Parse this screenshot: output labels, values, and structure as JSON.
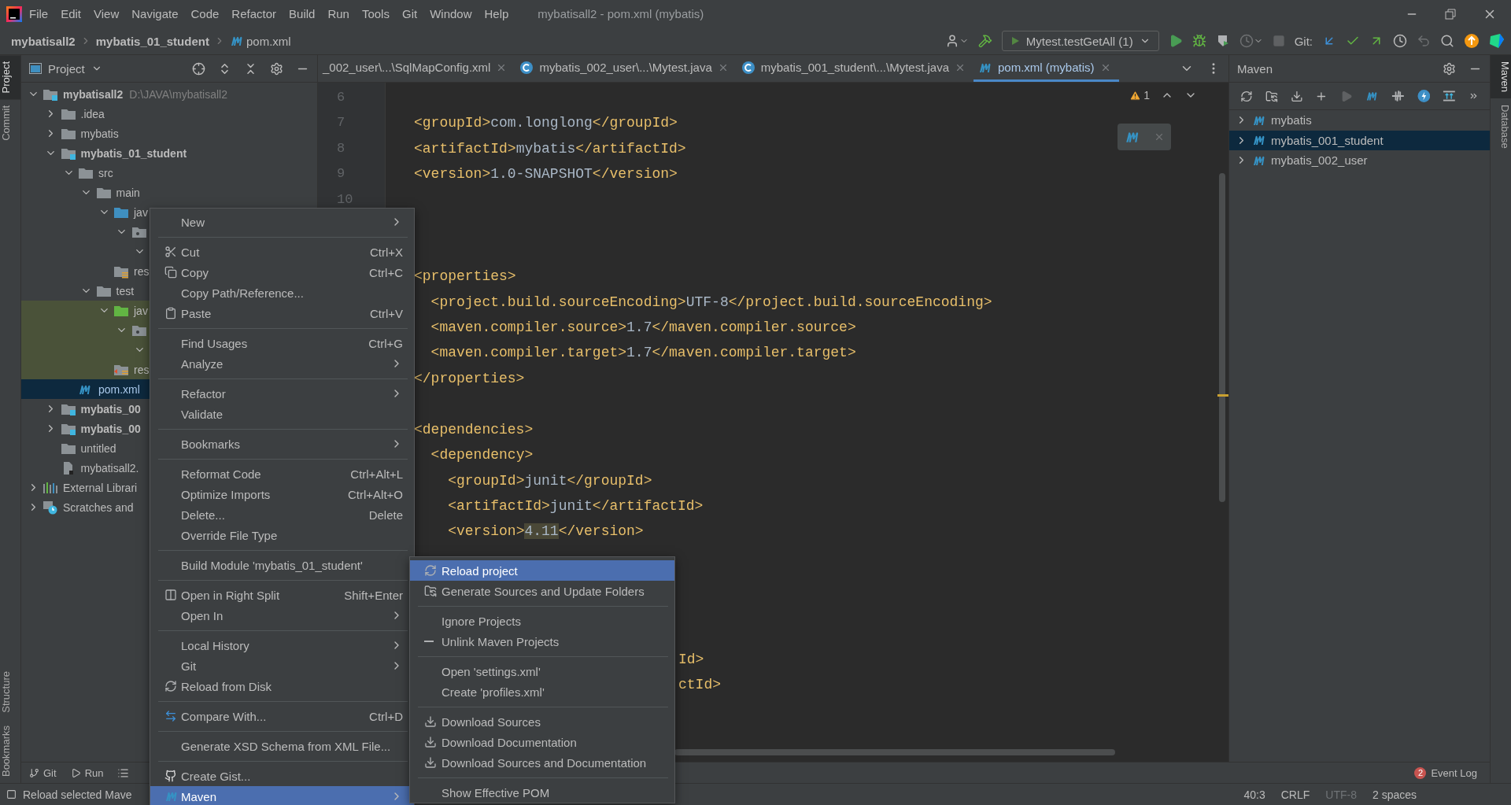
{
  "menu_bar": {
    "items": [
      "File",
      "Edit",
      "View",
      "Navigate",
      "Code",
      "Refactor",
      "Build",
      "Run",
      "Tools",
      "Git",
      "Window",
      "Help"
    ],
    "title": "mybatisall2 - pom.xml (mybatis)"
  },
  "nav_bar": {
    "breadcrumbs": [
      {
        "label": "mybatisall2",
        "kind": "text"
      },
      {
        "label": "mybatis_01_student",
        "kind": "text"
      },
      {
        "label": "pom.xml",
        "kind": "maven"
      }
    ],
    "run_config": "Mytest.testGetAll (1)",
    "git_label": "Git:"
  },
  "left_strip": {
    "top": [
      {
        "label": "Project",
        "selected": true
      },
      {
        "label": "Commit",
        "selected": false
      }
    ],
    "bottom": [
      {
        "label": "Structure",
        "selected": false
      },
      {
        "label": "Bookmarks",
        "selected": false
      }
    ]
  },
  "project_panel": {
    "title": "Project",
    "tree": [
      {
        "label": "mybatisall2",
        "detail": "D:\\JAVA\\mybatisall2",
        "kind": "module",
        "expanded": true,
        "selected": false,
        "children": [
          {
            "label": ".idea",
            "kind": "folder",
            "expanded": false,
            "selected": false
          },
          {
            "label": "mybatis",
            "kind": "folder",
            "expanded": false,
            "selected": false
          },
          {
            "label": "mybatis_01_student",
            "kind": "module",
            "expanded": true,
            "selected": false,
            "children": [
              {
                "label": "src",
                "kind": "folder",
                "expanded": true,
                "selected": false,
                "children": [
                  {
                    "label": "main",
                    "kind": "folder",
                    "expanded": true,
                    "selected": false,
                    "children": [
                      {
                        "label": "jav",
                        "kind": "source",
                        "expanded": true,
                        "selected": false,
                        "children": [
                          {
                            "kind": "package",
                            "expanded": true,
                            "selected": false,
                            "children": [
                              {
                                "expanded": true,
                                "selected": false
                              }
                            ]
                          }
                        ]
                      },
                      {
                        "label": "res",
                        "kind": "resources",
                        "selected": false
                      }
                    ]
                  },
                  {
                    "label": "test",
                    "kind": "folder",
                    "expanded": true,
                    "selected": false,
                    "children": [
                      {
                        "label": "jav",
                        "kind": "test-source",
                        "expanded": true,
                        "selected": false,
                        "highlighted": true,
                        "children": [
                          {
                            "kind": "package",
                            "expanded": true,
                            "selected": false,
                            "highlighted": true,
                            "children": [
                              {
                                "expanded": true,
                                "selected": false,
                                "highlighted": true
                              }
                            ]
                          }
                        ]
                      },
                      {
                        "label": "res",
                        "kind": "test-resources",
                        "selected": false,
                        "highlighted": true
                      }
                    ]
                  }
                ]
              },
              {
                "label": "pom.xml",
                "kind": "maven",
                "selected": true
              }
            ]
          },
          {
            "label": "mybatis_00",
            "kind": "module",
            "expanded": false,
            "selected": false
          },
          {
            "label": "mybatis_00",
            "kind": "module",
            "expanded": false,
            "selected": false
          },
          {
            "label": "untitled",
            "kind": "folder",
            "selected": false
          },
          {
            "label": "mybatisall2.",
            "kind": "file",
            "selected": false
          }
        ]
      },
      {
        "label": "External Librari",
        "kind": "library",
        "expanded": false,
        "selected": false
      },
      {
        "label": "Scratches and",
        "kind": "scratches",
        "expanded": false,
        "selected": false
      }
    ]
  },
  "editor": {
    "tabs": [
      {
        "label": "_002_user\\...\\SqlMapConfig.xml",
        "kind": "xml",
        "selected": false
      },
      {
        "label": "mybatis_002_user\\...\\Mytest.java",
        "kind": "class",
        "selected": false
      },
      {
        "label": "mybatis_001_student\\...\\Mytest.java",
        "kind": "class",
        "selected": false
      },
      {
        "label": "pom.xml (mybatis)",
        "kind": "maven",
        "selected": true
      }
    ],
    "warning_count": "1",
    "lines": [
      {
        "kind": "blank",
        "number": "6"
      },
      {
        "kind": "code",
        "number": "7",
        "text": "<groupId>com.longlong</groupId>"
      },
      {
        "kind": "code",
        "number": "8",
        "text": "<artifactId>mybatis</artifactId>"
      },
      {
        "kind": "code",
        "number": "9",
        "text": "<version>1.0-SNAPSHOT</version>"
      },
      {
        "kind": "blank",
        "number": "10"
      },
      {
        "kind": "blank"
      },
      {
        "kind": "blank"
      },
      {
        "kind": "code",
        "text": "<properties>"
      },
      {
        "kind": "code",
        "text": "  <project.build.sourceEncoding>UTF-8</project.build.sourceEncoding>"
      },
      {
        "kind": "code",
        "text": "  <maven.compiler.source>1.7</maven.compiler.source>"
      },
      {
        "kind": "code",
        "text": "  <maven.compiler.target>1.7</maven.compiler.target>"
      },
      {
        "kind": "code",
        "text": "</properties>"
      },
      {
        "kind": "blank"
      },
      {
        "kind": "code",
        "text": "<dependencies>"
      },
      {
        "kind": "code",
        "text": "  <dependency>"
      },
      {
        "kind": "code",
        "text": "    <groupId>junit</groupId>"
      },
      {
        "kind": "code",
        "text": "    <artifactId>junit</artifactId>"
      },
      {
        "kind": "parts",
        "parts": [
          {
            "text": "    <version>",
            "highlighted": false
          },
          {
            "text": "4.11",
            "highlighted": true
          },
          {
            "text": "</version>",
            "highlighted": false
          }
        ]
      },
      {
        "kind": "blank"
      },
      {
        "kind": "blank"
      },
      {
        "kind": "blank"
      },
      {
        "kind": "blank"
      },
      {
        "kind": "fragment",
        "text": "Id>"
      },
      {
        "kind": "fragment",
        "text": "ctId>"
      }
    ]
  },
  "context_menu": {
    "items": [
      {
        "label": "New",
        "kind": "plain",
        "submenu": true,
        "selected": false
      },
      {
        "kind": "separator"
      },
      {
        "label": "Cut",
        "kind": "cut",
        "shortcut": "Ctrl+X",
        "submenu": false,
        "selected": false
      },
      {
        "label": "Copy",
        "kind": "copy",
        "shortcut": "Ctrl+C",
        "submenu": false,
        "selected": false
      },
      {
        "label": "Copy Path/Reference...",
        "kind": "plain",
        "submenu": false,
        "selected": false
      },
      {
        "label": "Paste",
        "kind": "paste",
        "shortcut": "Ctrl+V",
        "submenu": false,
        "selected": false
      },
      {
        "kind": "separator"
      },
      {
        "label": "Find Usages",
        "kind": "plain",
        "shortcut": "Ctrl+G",
        "submenu": false,
        "selected": false
      },
      {
        "label": "Analyze",
        "kind": "plain",
        "submenu": true,
        "selected": false
      },
      {
        "kind": "separator"
      },
      {
        "label": "Refactor",
        "kind": "plain",
        "submenu": true,
        "selected": false
      },
      {
        "label": "Validate",
        "kind": "plain",
        "submenu": false,
        "selected": false
      },
      {
        "kind": "separator"
      },
      {
        "label": "Bookmarks",
        "kind": "plain",
        "submenu": true,
        "selected": false
      },
      {
        "kind": "separator"
      },
      {
        "label": "Reformat Code",
        "kind": "plain",
        "shortcut": "Ctrl+Alt+L",
        "submenu": false,
        "selected": false
      },
      {
        "label": "Optimize Imports",
        "kind": "plain",
        "shortcut": "Ctrl+Alt+O",
        "submenu": false,
        "selected": false
      },
      {
        "label": "Delete...",
        "kind": "plain",
        "shortcut": "Delete",
        "submenu": false,
        "selected": false
      },
      {
        "label": "Override File Type",
        "kind": "plain",
        "submenu": false,
        "selected": false
      },
      {
        "kind": "separator"
      },
      {
        "label": "Build Module 'mybatis_01_student'",
        "kind": "plain",
        "submenu": false,
        "selected": false
      },
      {
        "kind": "separator"
      },
      {
        "label": "Open in Right Split",
        "kind": "split",
        "shortcut": "Shift+Enter",
        "submenu": false,
        "selected": false
      },
      {
        "label": "Open In",
        "kind": "plain",
        "submenu": true,
        "selected": false
      },
      {
        "kind": "separator"
      },
      {
        "label": "Local History",
        "kind": "plain",
        "submenu": true,
        "selected": false
      },
      {
        "label": "Git",
        "kind": "plain",
        "submenu": true,
        "selected": false
      },
      {
        "label": "Reload from Disk",
        "kind": "reload",
        "submenu": false,
        "selected": false
      },
      {
        "kind": "separator"
      },
      {
        "label": "Compare With...",
        "kind": "compare",
        "shortcut": "Ctrl+D",
        "submenu": false,
        "selected": false
      },
      {
        "kind": "separator"
      },
      {
        "label": "Generate XSD Schema from XML File...",
        "kind": "plain",
        "submenu": false,
        "selected": false
      },
      {
        "kind": "separator"
      },
      {
        "label": "Create Gist...",
        "kind": "gist",
        "submenu": false,
        "selected": false
      },
      {
        "label": "Maven",
        "kind": "maven",
        "submenu": true,
        "selected": true
      }
    ]
  },
  "maven_submenu": {
    "items": [
      {
        "label": "Reload project",
        "kind": "reload",
        "selected": true
      },
      {
        "label": "Generate Sources and Update Folders",
        "kind": "generate",
        "selected": false
      },
      {
        "kind": "separator"
      },
      {
        "label": "Ignore Projects",
        "kind": "plain",
        "selected": false
      },
      {
        "label": "Unlink Maven Projects",
        "kind": "unlink",
        "selected": false
      },
      {
        "kind": "separator"
      },
      {
        "label": "Open 'settings.xml'",
        "kind": "plain",
        "selected": false
      },
      {
        "label": "Create 'profiles.xml'",
        "kind": "plain",
        "selected": false
      },
      {
        "kind": "separator"
      },
      {
        "label": "Download Sources",
        "kind": "download",
        "selected": false
      },
      {
        "label": "Download Documentation",
        "kind": "download",
        "selected": false
      },
      {
        "label": "Download Sources and Documentation",
        "kind": "download",
        "selected": false
      },
      {
        "kind": "separator"
      },
      {
        "label": "Show Effective POM",
        "kind": "plain",
        "selected": false
      }
    ]
  },
  "maven_panel": {
    "title": "Maven",
    "projects": [
      {
        "label": "mybatis",
        "expanded": false,
        "selected": false
      },
      {
        "label": "mybatis_001_student",
        "expanded": false,
        "selected": true
      },
      {
        "label": "mybatis_002_user",
        "expanded": false,
        "selected": false
      }
    ]
  },
  "right_strip": [
    {
      "label": "Maven",
      "selected": true
    },
    {
      "label": "Database",
      "selected": false
    }
  ],
  "tool_bar": {
    "items": [
      {
        "label": "Git",
        "kind": "git"
      },
      {
        "label": "Run",
        "kind": "run"
      }
    ],
    "event_log": {
      "label": "Event Log",
      "count": "2"
    }
  },
  "status_bar": {
    "message": "Reload selected Mave",
    "items": [
      {
        "label": "40:3",
        "disabled": false
      },
      {
        "label": "CRLF",
        "disabled": false
      },
      {
        "label": "UTF-8",
        "disabled": true
      },
      {
        "label": "2 spaces",
        "disabled": false
      }
    ]
  }
}
